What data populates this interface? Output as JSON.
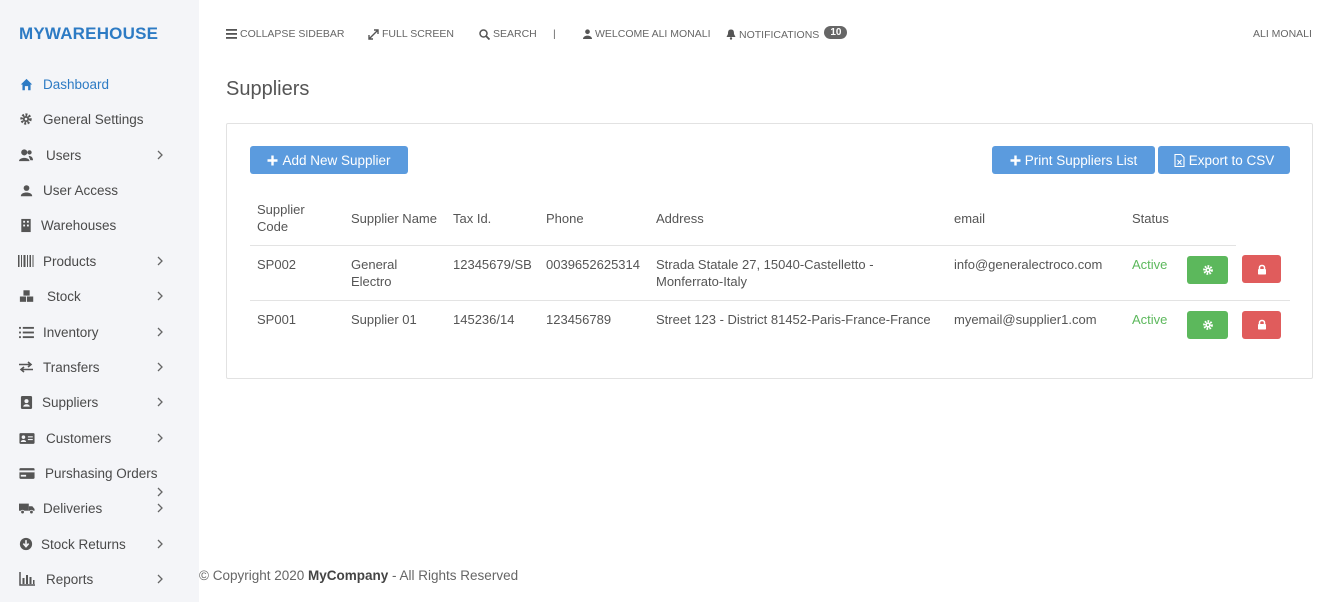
{
  "brand": "MYWAREHOUSE",
  "sidebar": {
    "items": [
      {
        "label": "Dashboard",
        "icon": "home-icon"
      },
      {
        "label": "General Settings",
        "icon": "gear-icon"
      },
      {
        "label": "Users",
        "icon": "users-icon"
      },
      {
        "label": "User Access",
        "icon": "user-icon"
      },
      {
        "label": "Warehouses",
        "icon": "building-icon"
      },
      {
        "label": "Products",
        "icon": "barcode-icon"
      },
      {
        "label": "Stock",
        "icon": "cubes-icon"
      },
      {
        "label": "Inventory",
        "icon": "list-icon"
      },
      {
        "label": "Transfers",
        "icon": "exchange-icon"
      },
      {
        "label": "Suppliers",
        "icon": "address-book-icon"
      },
      {
        "label": "Customers",
        "icon": "address-card-icon"
      },
      {
        "label": "Purshasing Orders",
        "icon": "credit-card-icon"
      },
      {
        "label": "Deliveries",
        "icon": "truck-icon"
      },
      {
        "label": "Stock Returns",
        "icon": "arrow-circle-down-icon"
      },
      {
        "label": "Reports",
        "icon": "bar-chart-icon"
      }
    ]
  },
  "topbar": {
    "collapse": "COLLAPSE SIDEBAR",
    "fullscreen": "FULL SCREEN",
    "search": "SEARCH",
    "separator": "|",
    "welcome": "WELCOME ALI MONALI",
    "notifications": "NOTIFICATIONS",
    "notifications_count": "10",
    "user": "ALI MONALI"
  },
  "page": {
    "title": "Suppliers",
    "add_button": "Add New Supplier",
    "print_button": "Print Suppliers List",
    "export_button": "Export to CSV"
  },
  "table": {
    "headers": {
      "code": "Supplier Code",
      "name": "Supplier Name",
      "tax": "Tax Id.",
      "phone": "Phone",
      "address": "Address",
      "email": "email",
      "status": "Status"
    },
    "rows": [
      {
        "code": "SP002",
        "name": "General Electro",
        "tax": "12345679/SB",
        "phone": "0039652625314",
        "address": "Strada Statale 27, 15040-Castelletto - Monferrato-Italy",
        "email": "info@generalectroco.com",
        "status": "Active"
      },
      {
        "code": "SP001",
        "name": "Supplier 01",
        "tax": "145236/14",
        "phone": "123456789",
        "address": "Street 123 - District 81452-Paris-France-France",
        "email": "myemail@supplier1.com",
        "status": "Active"
      }
    ]
  },
  "footer": {
    "prefix": "© Copyright 2020 ",
    "company": "MyCompany",
    "suffix": " - All Rights Reserved"
  },
  "colors": {
    "brand": "#2d7bc4",
    "primary_button": "#5b9bde",
    "success": "#5cb85c",
    "danger": "#e05c5c"
  }
}
